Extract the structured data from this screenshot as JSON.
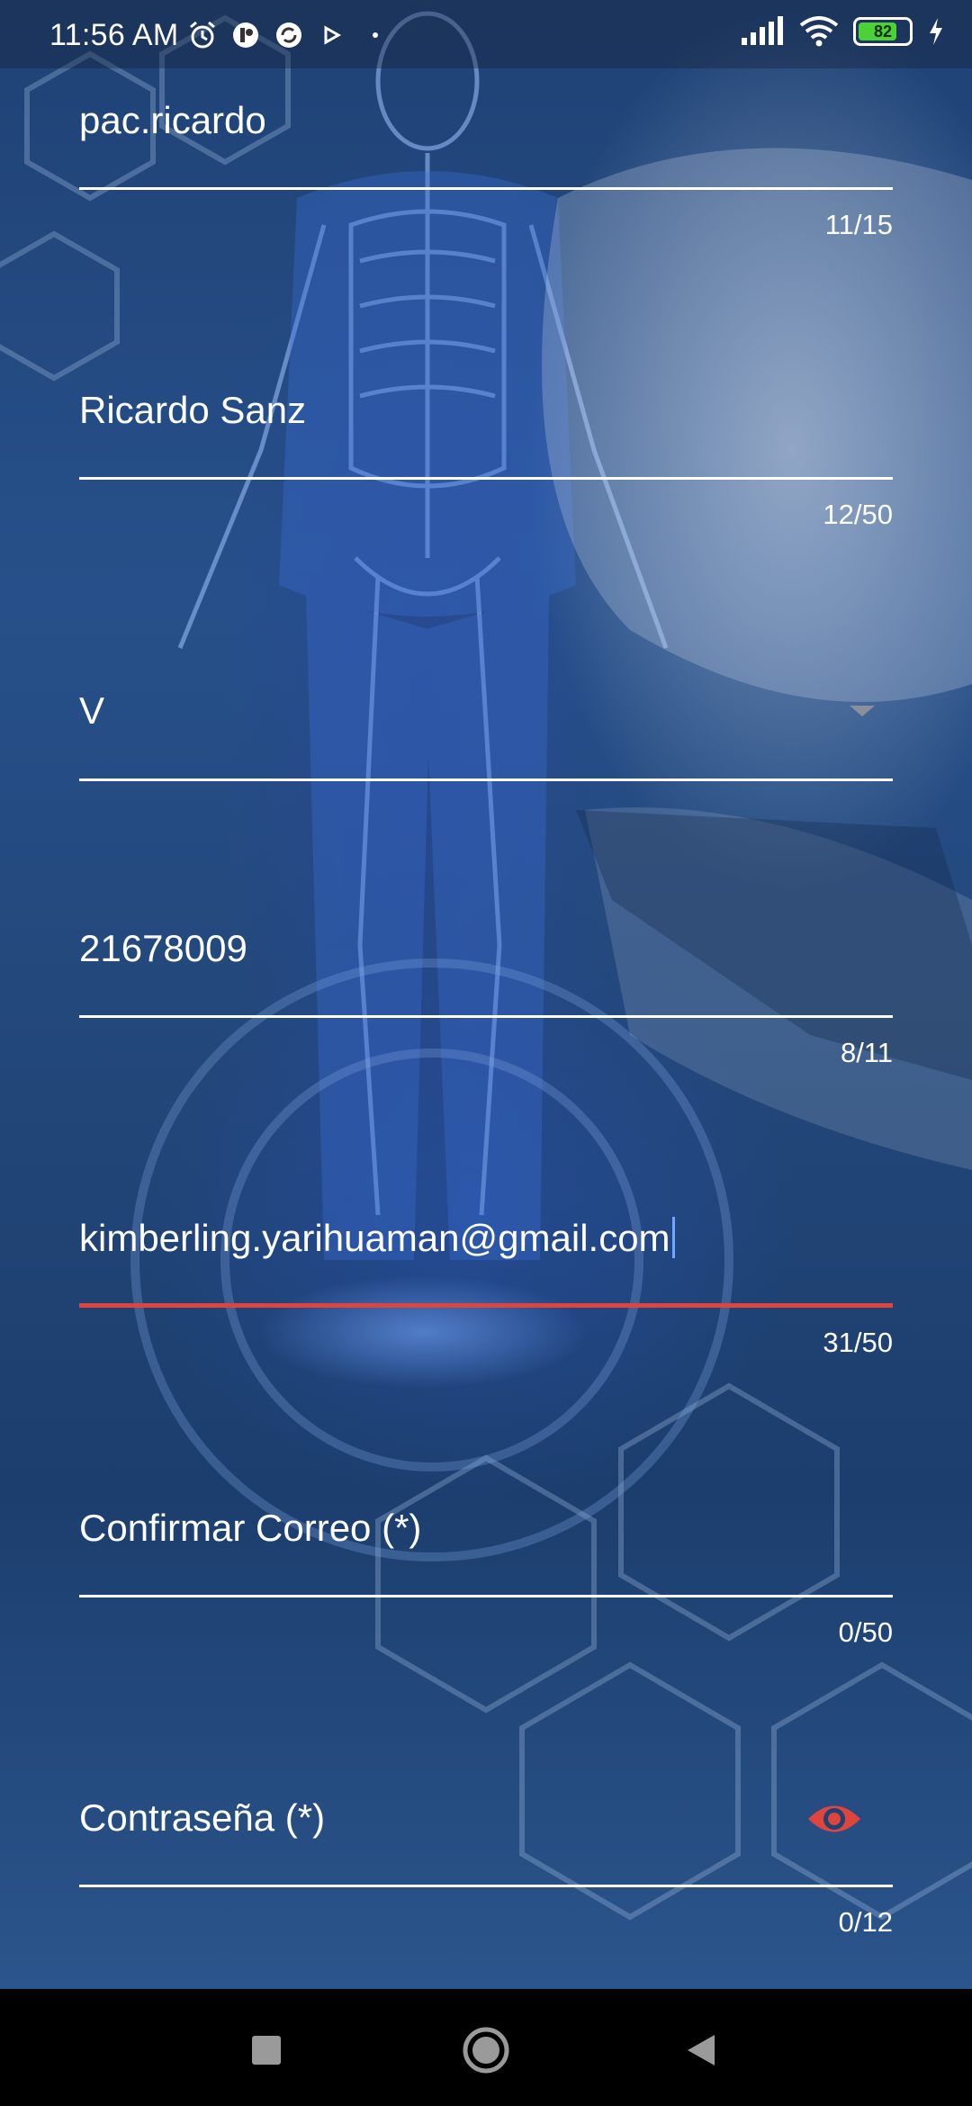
{
  "status_bar": {
    "time": "11:56 AM",
    "battery_level": "82",
    "icons": [
      "alarm-icon",
      "app-notification-icon",
      "sync-icon",
      "play-icon",
      "dot-icon",
      "signal-icon",
      "wifi-icon",
      "battery-icon",
      "charging-icon"
    ]
  },
  "form": {
    "username": {
      "value": "pac.ricardo",
      "counter": "11/15"
    },
    "full_name": {
      "value": "Ricardo Sanz",
      "counter": "12/50"
    },
    "document_type": {
      "value": "V"
    },
    "document_number": {
      "value": "21678009",
      "counter": "8/11"
    },
    "email": {
      "value": "kimberling.yarihuaman@gmail.com",
      "counter": "31/50"
    },
    "confirm_email": {
      "placeholder": "Confirmar Correo (*)",
      "counter": "0/50"
    },
    "password": {
      "placeholder": "Contraseña (*)",
      "counter": "0/12"
    }
  },
  "colors": {
    "accent_error": "#e0453d",
    "eye_icon": "#e0453d",
    "cursor": "#6fa8ff"
  },
  "nav_bar": {
    "buttons": [
      "recents-button",
      "home-button",
      "back-button"
    ]
  }
}
